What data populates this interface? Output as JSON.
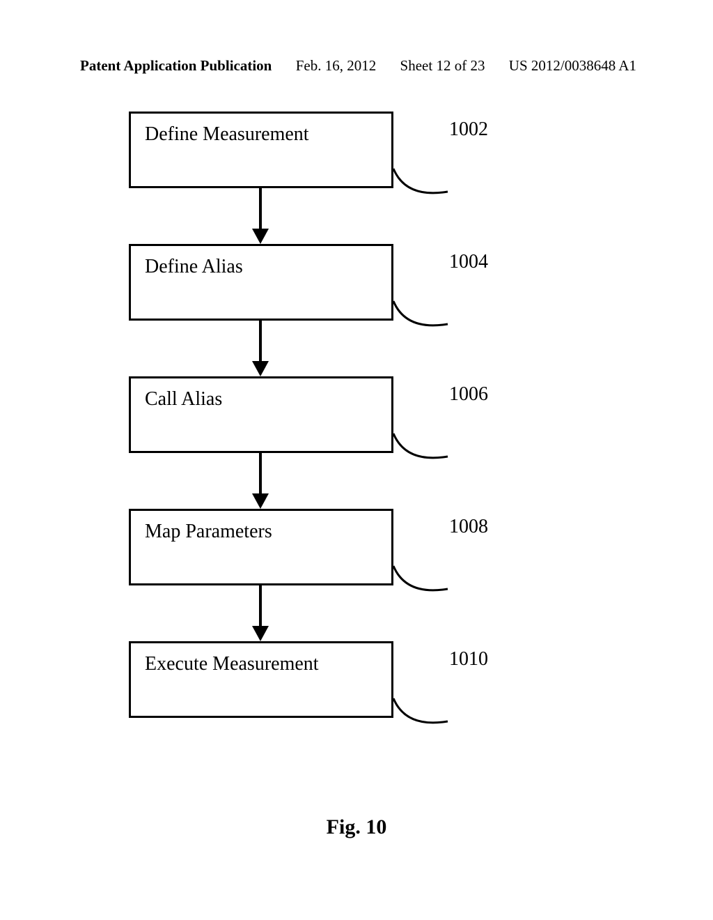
{
  "header": {
    "pub_type": "Patent Application Publication",
    "date": "Feb. 16, 2012",
    "sheet": "Sheet 12 of 23",
    "pub_number": "US 2012/0038648 A1"
  },
  "flowchart": {
    "steps": [
      {
        "label": "Define Measurement",
        "ref": "1002"
      },
      {
        "label": "Define Alias",
        "ref": "1004"
      },
      {
        "label": "Call Alias",
        "ref": "1006"
      },
      {
        "label": "Map Parameters",
        "ref": "1008"
      },
      {
        "label": "Execute Measurement",
        "ref": "1010"
      }
    ]
  },
  "figure_caption": "Fig. 10"
}
